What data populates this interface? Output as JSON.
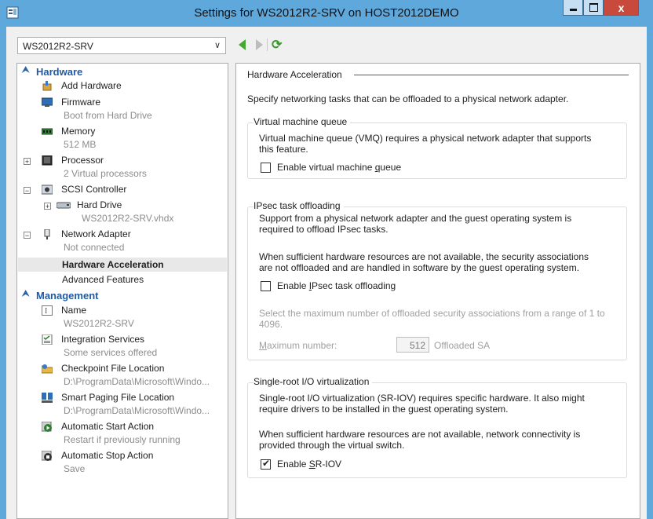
{
  "window": {
    "title": "Settings for WS2012R2-SRV on HOST2012DEMO",
    "controls": {
      "minimize": "–",
      "maximize": "□",
      "close": "x"
    },
    "colors": {
      "titlebar": "#5fa8dc",
      "close": "#c74a3c"
    }
  },
  "vm_selector": {
    "value": "WS2012R2-SRV"
  },
  "toolbar": {
    "back_icon": "back-arrow-icon",
    "forward_icon": "forward-arrow-icon",
    "refresh_icon": "refresh-icon"
  },
  "tree": {
    "hardware_header": "Hardware",
    "add_hardware": "Add Hardware",
    "firmware": {
      "label": "Firmware",
      "sub": "Boot from Hard Drive"
    },
    "memory": {
      "label": "Memory",
      "sub": "512 MB"
    },
    "processor": {
      "label": "Processor",
      "sub": "2 Virtual processors"
    },
    "scsi": {
      "label": "SCSI Controller"
    },
    "hard_drive": {
      "label": "Hard Drive",
      "sub": "WS2012R2-SRV.vhdx"
    },
    "network_adapter": {
      "label": "Network Adapter",
      "sub": "Not connected"
    },
    "hardware_acceleration": "Hardware Acceleration",
    "advanced_features": "Advanced Features",
    "management_header": "Management",
    "name": {
      "label": "Name",
      "sub": "WS2012R2-SRV"
    },
    "integration_services": {
      "label": "Integration Services",
      "sub": "Some services offered"
    },
    "checkpoint_location": {
      "label": "Checkpoint File Location",
      "sub": "D:\\ProgramData\\Microsoft\\Windo..."
    },
    "smart_paging": {
      "label": "Smart Paging File Location",
      "sub": "D:\\ProgramData\\Microsoft\\Windo..."
    },
    "auto_start": {
      "label": "Automatic Start Action",
      "sub": "Restart if previously running"
    },
    "auto_stop": {
      "label": "Automatic Stop Action",
      "sub": "Save"
    }
  },
  "panel": {
    "header": "Hardware Acceleration",
    "intro": "Specify networking tasks that can be offloaded to a physical network adapter.",
    "vmq": {
      "title": "Virtual machine queue",
      "desc_line1": "Virtual machine queue (VMQ) requires a physical network adapter that supports",
      "desc_line2": "this feature.",
      "checkbox_pre": "Enable virtual machine ",
      "checkbox_key": "q",
      "checkbox_post": "ueue",
      "checked": false
    },
    "ipsec": {
      "title": "IPsec task offloading",
      "desc1_line1": "Support from a physical network adapter and the guest operating system is",
      "desc1_line2": "required to offload IPsec tasks.",
      "desc2_line1": "When sufficient hardware resources are not available, the security associations",
      "desc2_line2": "are not offloaded and are handled in software by the guest operating system.",
      "checkbox_pre": "Enable ",
      "checkbox_key": "I",
      "checkbox_post": "Psec task offloading",
      "checked": false,
      "max_desc_line1": "Select the maximum number of offloaded security associations from a range of 1 to",
      "max_desc_line2": "4096.",
      "max_label_key": "M",
      "max_label_rest": "aximum number:",
      "max_value": "512",
      "max_unit": "Offloaded SA"
    },
    "sriov": {
      "title": "Single-root I/O virtualization",
      "desc1_line1": "Single-root I/O virtualization (SR-IOV) requires specific hardware. It also might",
      "desc1_line2": "require drivers to be installed in the guest operating system.",
      "desc2_line1": "When sufficient hardware resources are not available, network connectivity is",
      "desc2_line2": "provided through the virtual switch.",
      "checkbox_pre": "Enable ",
      "checkbox_key": "S",
      "checkbox_post": "R-IOV",
      "checked": true
    }
  }
}
